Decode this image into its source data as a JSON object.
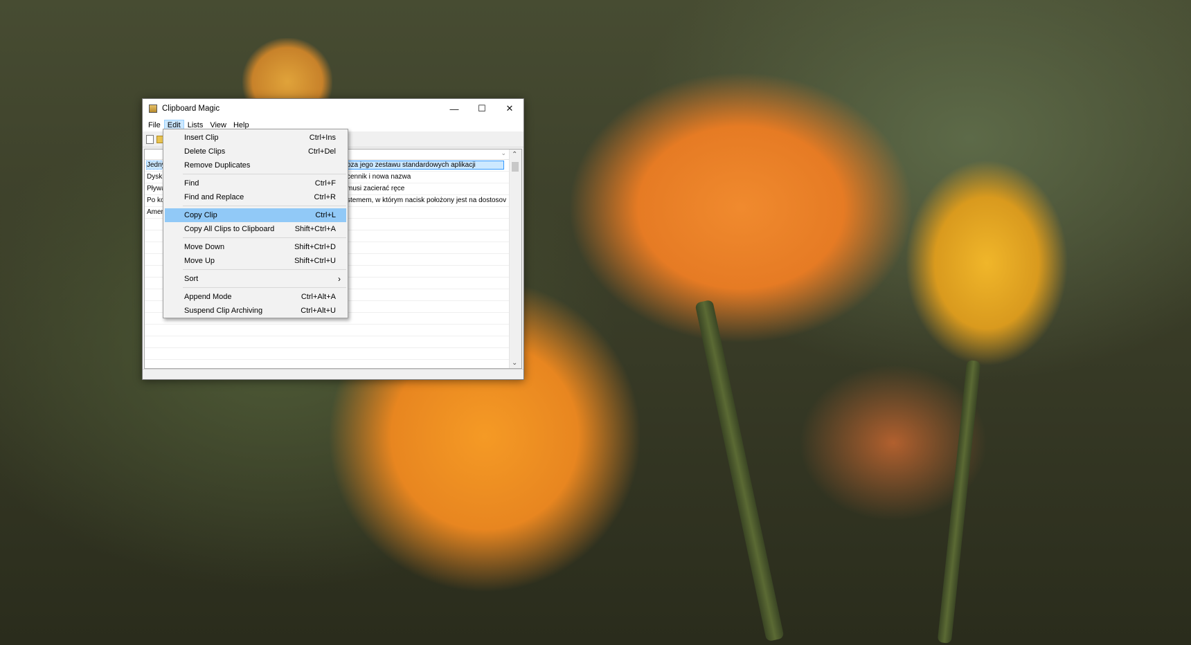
{
  "window": {
    "title": "Clipboard Magic",
    "controls": {
      "minimize": "—",
      "maximize": "☐",
      "close": "✕"
    }
  },
  "menubar": [
    "File",
    "Edit",
    "Lists",
    "View",
    "Help"
  ],
  "active_menu": "Edit",
  "clips": [
    {
      "lead": "Jedny",
      "rest": "oza jego zestawu standardowych aplikacji",
      "selected": true
    },
    {
      "lead": "Dysk",
      "rest": "cennik i nowa nazwa",
      "selected": false
    },
    {
      "lead": "Pływa",
      "rest": "musi zacierać ręce",
      "selected": false
    },
    {
      "lead": "Po ko",
      "rest": "stemem, w którym nacisk położony jest na dostosov",
      "selected": false
    },
    {
      "lead": "Amer",
      "rest": "",
      "selected": false
    }
  ],
  "edit_menu": {
    "groups": [
      [
        {
          "label": "Insert Clip",
          "shortcut": "Ctrl+Ins"
        },
        {
          "label": "Delete Clips",
          "shortcut": "Ctrl+Del"
        },
        {
          "label": "Remove Duplicates",
          "shortcut": ""
        }
      ],
      [
        {
          "label": "Find",
          "shortcut": "Ctrl+F"
        },
        {
          "label": "Find and Replace",
          "shortcut": "Ctrl+R"
        }
      ],
      [
        {
          "label": "Copy Clip",
          "shortcut": "Ctrl+L",
          "highlighted": true
        },
        {
          "label": "Copy All Clips to Clipboard",
          "shortcut": "Shift+Ctrl+A"
        }
      ],
      [
        {
          "label": "Move Down",
          "shortcut": "Shift+Ctrl+D"
        },
        {
          "label": "Move Up",
          "shortcut": "Shift+Ctrl+U"
        }
      ],
      [
        {
          "label": "Sort",
          "shortcut": "",
          "submenu": true
        }
      ],
      [
        {
          "label": "Append Mode",
          "shortcut": "Ctrl+Alt+A"
        },
        {
          "label": "Suspend Clip Archiving",
          "shortcut": "Ctrl+Alt+U"
        }
      ]
    ]
  }
}
